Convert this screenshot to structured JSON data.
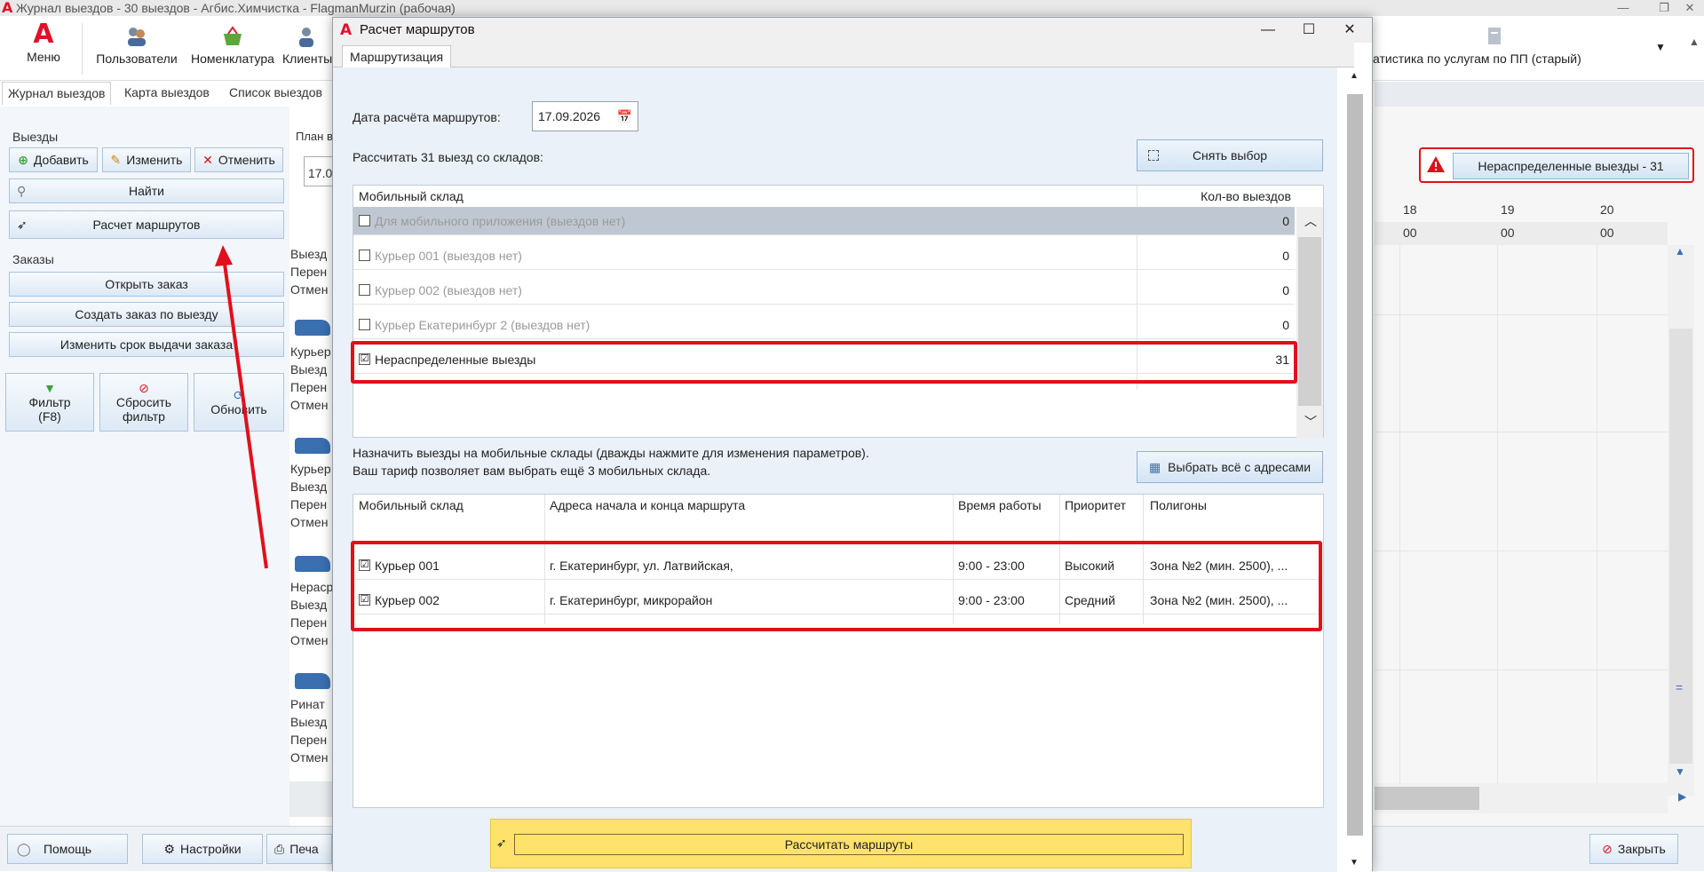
{
  "main_window": {
    "title": "Журнал выездов - 30 выездов - Агбис.Химчистка - FlagmanMurzin (рабочая)",
    "logo": "A",
    "ribbon": [
      {
        "label": "Меню",
        "icon": "app-logo-icon"
      },
      {
        "label": "Пользователи",
        "icon": "users-icon"
      },
      {
        "label": "Номенклатура",
        "icon": "basket-icon"
      },
      {
        "label": "Клиенты",
        "icon": "client-icon"
      },
      {
        "label": "атистика по услугам по ПП (старый)",
        "icon": "report-icon"
      }
    ],
    "tabs": [
      "Журнал выездов",
      "Карта выездов",
      "Список выездов"
    ],
    "left_panel": {
      "group_trips": "Выезды",
      "add": "Добавить",
      "edit": "Изменить",
      "cancel": "Отменить",
      "find": "Найти",
      "route_calc": "Расчет маршрутов",
      "group_orders": "Заказы",
      "open_order": "Открыть заказ",
      "create_order": "Создать заказ по выезду",
      "change_due": "Изменить срок выдачи заказа",
      "filter": "Фильтр\n(F8)",
      "reset_filter": "Сбросить\nфильтр",
      "refresh": "Обновить"
    },
    "schedule": {
      "plan_label": "План в",
      "date_partial": "17.0",
      "blocks": [
        [
          "Выезд",
          "Перен",
          "Отмен"
        ],
        [
          "Курьер",
          "Выезд",
          "Перен",
          "Отмен"
        ],
        [
          "Курьер",
          "Выезд",
          "Перен",
          "Отмен"
        ],
        [
          "Нераср",
          "Выезд",
          "Перен",
          "Отмен"
        ],
        [
          "Ринат",
          "Выезд",
          "Перен",
          "Отмен"
        ]
      ]
    },
    "right": {
      "unassigned_button": "Нераспределенные выезды - 31",
      "hours": [
        "18",
        "19",
        "20"
      ],
      "minutes": [
        "00",
        "00",
        "00"
      ]
    },
    "bottom": {
      "help": "Помощь",
      "settings": "Настройки",
      "print": "Печа",
      "close": "Закрыть"
    }
  },
  "dialog": {
    "title": "Расчет маршрутов",
    "tab": "Маршрутизация",
    "date_label": "Дата расчёта маршрутов:",
    "date_value": "17.09.2026",
    "calc_from_label": "Рассчитать 31 выезд со складов:",
    "deselect_button": "Снять выбор",
    "warehouses_table": {
      "headers": [
        "Мобильный склад",
        "Кол-во выездов"
      ],
      "rows": [
        {
          "name": "Для мобильного приложения (выездов нет)",
          "count": "0",
          "checked": false,
          "dim": true
        },
        {
          "name": "Курьер 001 (выездов нет)",
          "count": "0",
          "checked": false,
          "dim": true
        },
        {
          "name": "Курьер 002 (выездов нет)",
          "count": "0",
          "checked": false,
          "dim": true
        },
        {
          "name": "Курьер Екатеринбург 2 (выездов нет)",
          "count": "0",
          "checked": false,
          "dim": true
        },
        {
          "name": "Нераспределенные выезды",
          "count": "31",
          "checked": true,
          "dim": false
        }
      ]
    },
    "assign_text_1": "Назначить выезды на мобильные склады (дважды нажмите для изменения параметров).",
    "assign_text_2": "Ваш тариф позволяет вам выбрать ещё 3 мобильных склада.",
    "select_all_button": "Выбрать всё с адресами",
    "couriers_table": {
      "headers": [
        "Мобильный склад",
        "Адреса начала и конца маршрута",
        "Время работы",
        "Приоритет",
        "Полигоны"
      ],
      "rows": [
        {
          "name": "Курьер 001",
          "address": "г. Екатеринбург, ул. Латвийская,",
          "hours": "9:00 - 23:00",
          "priority": "Высокий",
          "polygons": "Зона №2 (мин. 2500), ...",
          "checked": true
        },
        {
          "name": "Курьер 002",
          "address": "г. Екатеринбург, микрорайон",
          "hours": "9:00 - 23:00",
          "priority": "Средний",
          "polygons": "Зона №2 (мин. 2500), ...",
          "checked": true
        }
      ]
    },
    "calculate_button": "Рассчитать маршруты",
    "check_mark": "☑"
  },
  "colors": {
    "annotation_red": "#e0101c",
    "brand_red": "#e0102a",
    "calc_bar": "#ffe26b"
  }
}
